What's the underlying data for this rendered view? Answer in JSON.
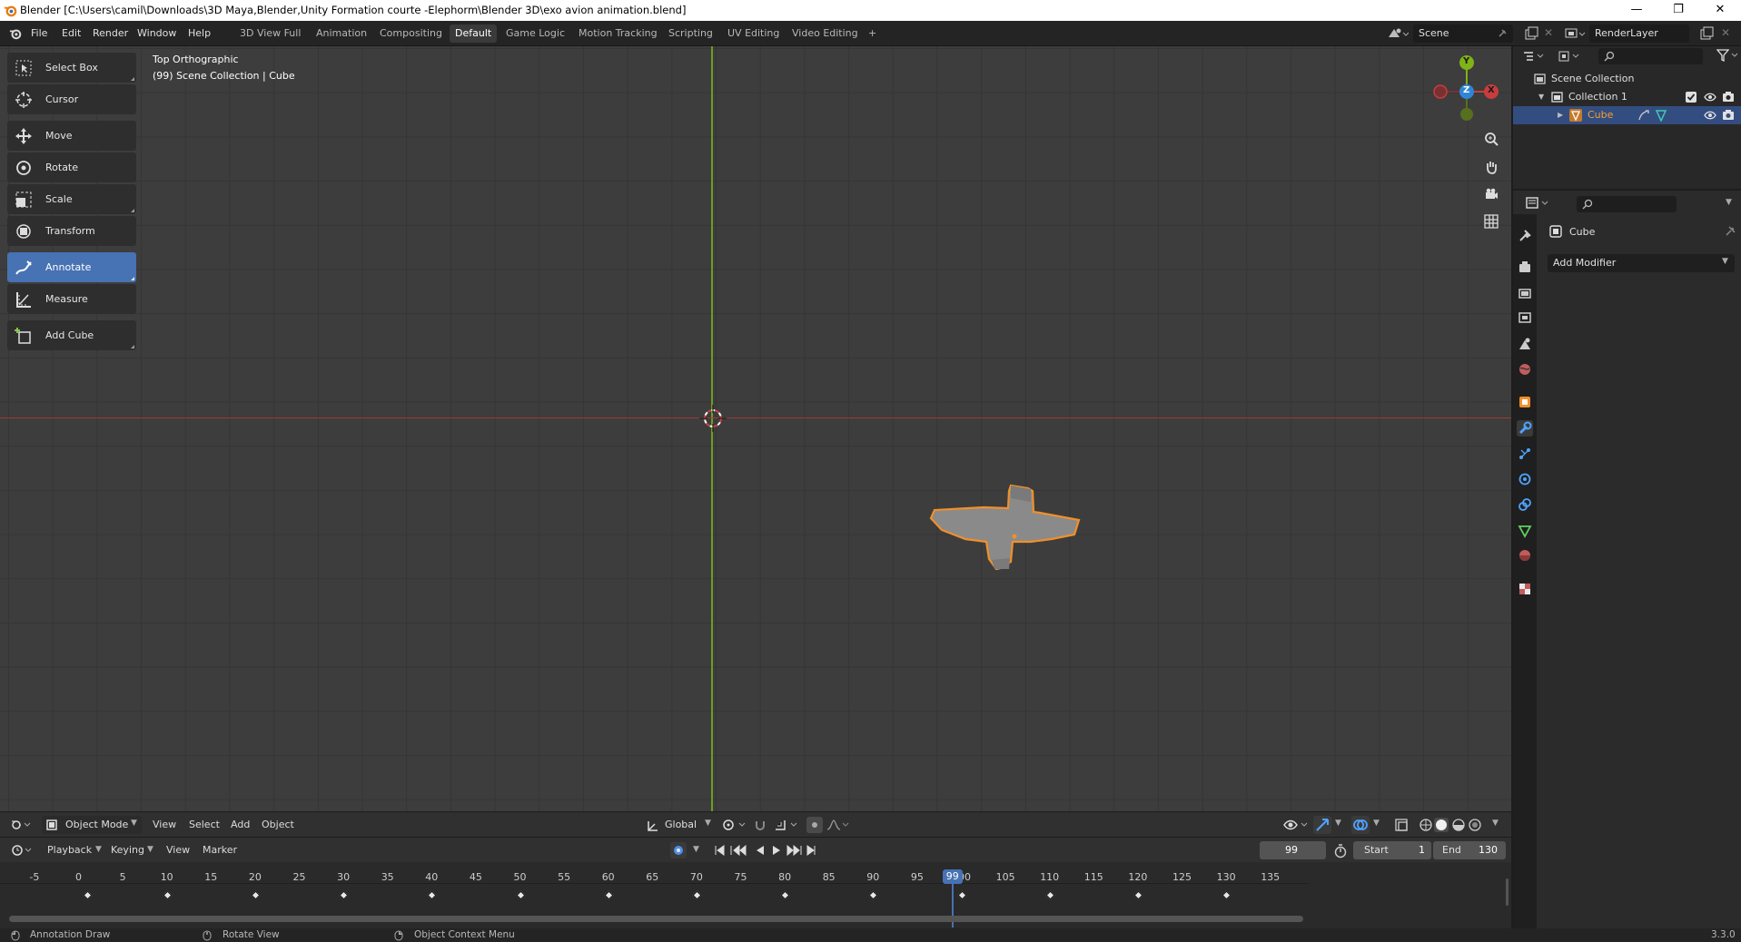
{
  "window": {
    "title": "Blender [C:\\Users\\camil\\Downloads\\3D Maya,Blender,Unity Formation courte -Elephorm\\Blender 3D\\exo avion animation.blend]",
    "minimize": "—",
    "maximize": "❐",
    "close": "✕"
  },
  "topbar": {
    "menus": [
      "File",
      "Edit",
      "Render",
      "Window",
      "Help"
    ],
    "workspaces": [
      "3D View Full",
      "Animation",
      "Compositing",
      "Default",
      "Game Logic",
      "Motion Tracking",
      "Scripting",
      "UV Editing",
      "Video Editing"
    ],
    "active_workspace": "Default",
    "add_workspace": "+",
    "scene": "Scene",
    "view_layer": "RenderLayer"
  },
  "toolbar": {
    "tools": [
      "Select Box",
      "Cursor",
      "Move",
      "Rotate",
      "Scale",
      "Transform",
      "Annotate",
      "Measure",
      "Add Cube"
    ],
    "active_tool": "Annotate"
  },
  "viewport": {
    "view_name": "Top Orthographic",
    "view_info": "(99) Scene Collection | Cube",
    "gizmo": {
      "y": "Y",
      "z": "Z",
      "x": "X"
    }
  },
  "viewport_header": {
    "mode": "Object Mode",
    "menus": [
      "View",
      "Select",
      "Add",
      "Object"
    ],
    "orientation": "Global"
  },
  "timeline": {
    "menus": [
      "Playback",
      "Keying",
      "View",
      "Marker"
    ],
    "current_frame": "99",
    "start_label": "Start",
    "start": "1",
    "end_label": "End",
    "end": "130",
    "ticks": [
      "-5",
      "0",
      "5",
      "10",
      "15",
      "20",
      "25",
      "30",
      "35",
      "40",
      "45",
      "50",
      "55",
      "60",
      "65",
      "70",
      "75",
      "80",
      "85",
      "90",
      "95",
      "100",
      "105",
      "110",
      "115",
      "120",
      "125",
      "130",
      "135"
    ],
    "tick_values": [
      -5,
      0,
      5,
      10,
      15,
      20,
      25,
      30,
      35,
      40,
      45,
      50,
      55,
      60,
      65,
      70,
      75,
      80,
      85,
      90,
      95,
      100,
      105,
      110,
      115,
      120,
      125,
      130,
      135
    ],
    "keyframes": [
      1,
      10,
      20,
      30,
      40,
      50,
      60,
      70,
      80,
      90,
      100,
      110,
      120,
      130
    ],
    "playhead_label": "99",
    "playhead": 99
  },
  "statusbar": {
    "left": "Annotation Draw",
    "middle": "Rotate View",
    "right": "Object Context Menu",
    "version": "3.3.0"
  },
  "outliner": {
    "scene_collection": "Scene Collection",
    "collection": "Collection 1",
    "object": "Cube"
  },
  "properties": {
    "object_name": "Cube",
    "add_modifier": "Add Modifier"
  },
  "colors": {
    "accent": "#4772b3",
    "selection_outline": "#f0902a",
    "x_axis": "#c73d3d",
    "y_axis": "#7fb317",
    "z_axis": "#2f86d6"
  }
}
